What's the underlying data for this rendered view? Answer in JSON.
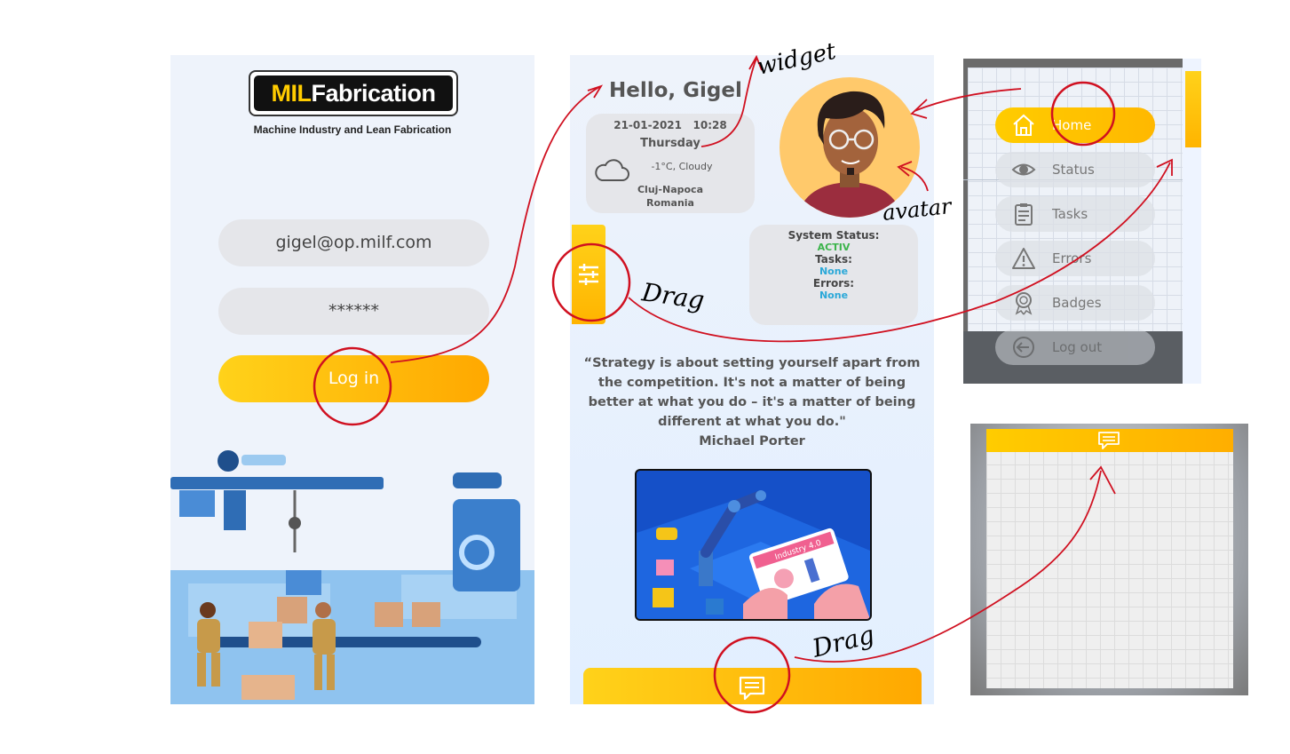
{
  "login": {
    "logo_prefix": "MIL",
    "logo_rest": "Fabrication",
    "logo_subtitle": "Machine Industry and Lean Fabrication",
    "email_value": "gigel@op.milf.com",
    "password_value": "******",
    "login_label": "Log in"
  },
  "home": {
    "greeting": "Hello, Gigel",
    "widget": {
      "date": "21-01-2021",
      "time": "10:28",
      "day": "Thursday",
      "weather": "-1°C, Cloudy",
      "city": "Cluj-Napoca",
      "country": "Romania"
    },
    "status": {
      "system_label": "System Status:",
      "system_value": "ACTIV",
      "tasks_label": "Tasks:",
      "tasks_value": "None",
      "errors_label": "Errors:",
      "errors_value": "None"
    },
    "quote_text": "“Strategy is about setting yourself apart from the competition. It's not a matter of being better at what you do – it's a matter of being different at what you do.\"",
    "quote_author": "Michael Porter",
    "illustration_label": "Industry 4.0"
  },
  "menu": {
    "items": [
      {
        "label": "Home",
        "icon": "home-icon",
        "active": true
      },
      {
        "label": "Status",
        "icon": "eye-icon"
      },
      {
        "label": "Tasks",
        "icon": "clipboard-icon"
      },
      {
        "label": "Errors",
        "icon": "warning-icon"
      },
      {
        "label": "Badges",
        "icon": "badge-icon"
      },
      {
        "label": "Log out",
        "icon": "logout-icon"
      }
    ]
  },
  "annotations": {
    "widget": "widget",
    "avatar": "avatar",
    "drag_1": "Drag",
    "drag_2": "Drag"
  },
  "colors": {
    "accent_yellow": "#ffcc00",
    "accent_orange": "#ffa800",
    "status_green": "#3cb44b",
    "status_blue": "#2aa8d8",
    "annotation_red": "#d01020"
  }
}
